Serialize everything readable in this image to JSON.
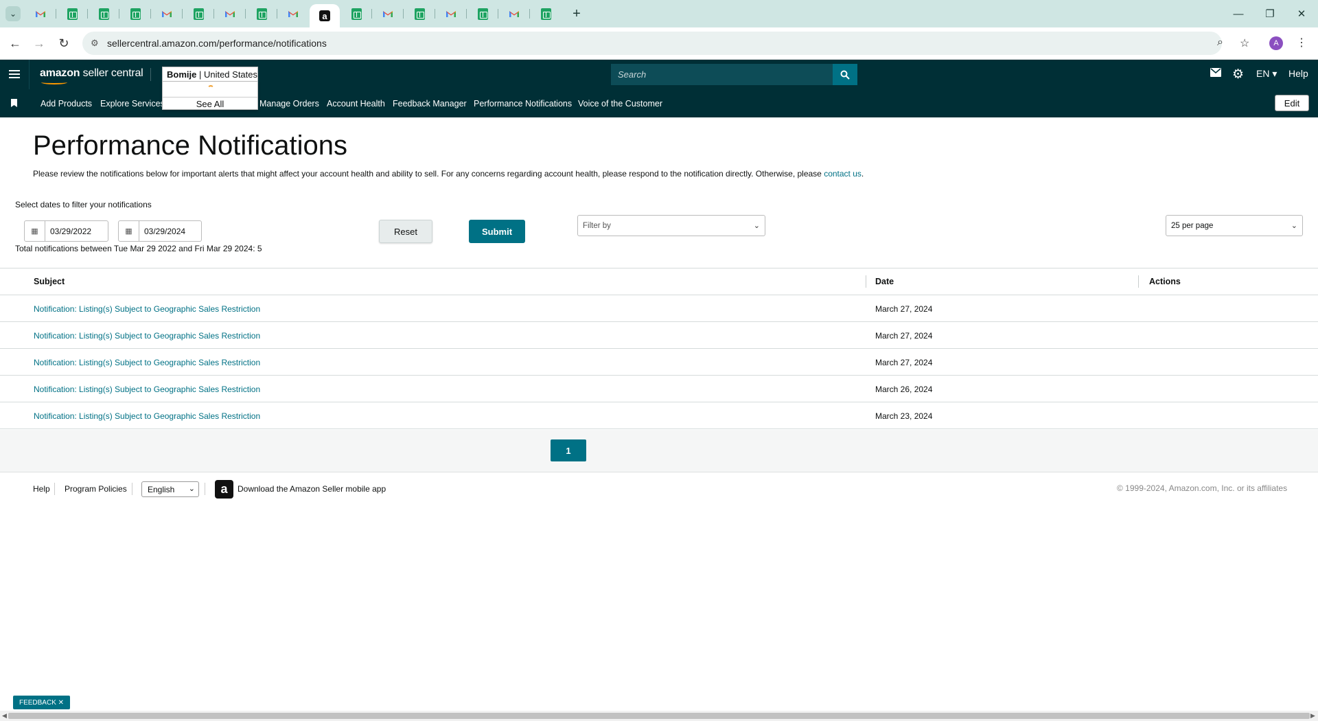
{
  "browser": {
    "url": "sellercentral.amazon.com/performance/notifications",
    "tab_icons": [
      "gmail-icon",
      "sheets-icon",
      "sheets-icon",
      "sheets-icon",
      "gmail-icon",
      "sheets-icon",
      "gmail-icon",
      "sheets-icon",
      "gmail-icon",
      "amazon-icon",
      "sheets-icon",
      "gmail-icon",
      "sheets-icon",
      "gmail-icon",
      "sheets-icon",
      "gmail-icon",
      "sheets-icon"
    ],
    "active_tab_index": 9,
    "profile_initial": "A"
  },
  "header": {
    "logo_bold": "amazon",
    "logo_rest": " seller central",
    "account_store": "Bomije",
    "account_sep": " | ",
    "account_region": "United States",
    "see_all": "See All",
    "search_placeholder": "Search",
    "language": "EN ▾",
    "help": "Help"
  },
  "nav": {
    "items": [
      "Add Products",
      "Explore Services",
      "Manage Orders",
      "Account Health",
      "Feedback Manager",
      "Performance Notifications",
      "Voice of the Customer"
    ],
    "edit": "Edit"
  },
  "page": {
    "title": "Performance Notifications",
    "description": "Please review the notifications below for important alerts that might affect your account health and ability to sell. For any concerns regarding account health, please respond to the notification directly. Otherwise, please ",
    "contact_link": "contact us",
    "description_end": ".",
    "select_dates_label": "Select dates to filter your notifications",
    "date_from": "03/29/2022",
    "date_to": "03/29/2024",
    "totals_text": "Total notifications between Tue Mar 29 2022 and Fri Mar 29 2024: 5",
    "reset": "Reset",
    "submit": "Submit",
    "filter_placeholder": "Filter by",
    "per_page": "25 per page"
  },
  "table": {
    "columns": [
      "Subject",
      "Date",
      "Actions"
    ],
    "rows": [
      {
        "subject": "Notification: Listing(s) Subject to Geographic Sales Restriction",
        "date": "March 27, 2024"
      },
      {
        "subject": "Notification: Listing(s) Subject to Geographic Sales Restriction",
        "date": "March 27, 2024"
      },
      {
        "subject": "Notification: Listing(s) Subject to Geographic Sales Restriction",
        "date": "March 27, 2024"
      },
      {
        "subject": "Notification: Listing(s) Subject to Geographic Sales Restriction",
        "date": "March 26, 2024"
      },
      {
        "subject": "Notification: Listing(s) Subject to Geographic Sales Restriction",
        "date": "March 23, 2024"
      }
    ]
  },
  "pagination": {
    "current_page": "1"
  },
  "footer": {
    "help": "Help",
    "program_policies": "Program Policies",
    "language": "English",
    "app_text": "Download the Amazon Seller mobile app",
    "copyright": "© 1999-2024, Amazon.com, Inc. or its affiliates"
  },
  "feedback": "FEEDBACK ✕",
  "colors": {
    "nav_bg": "#002f36",
    "accent": "#007185",
    "tabbar": "#cfe6e3"
  }
}
